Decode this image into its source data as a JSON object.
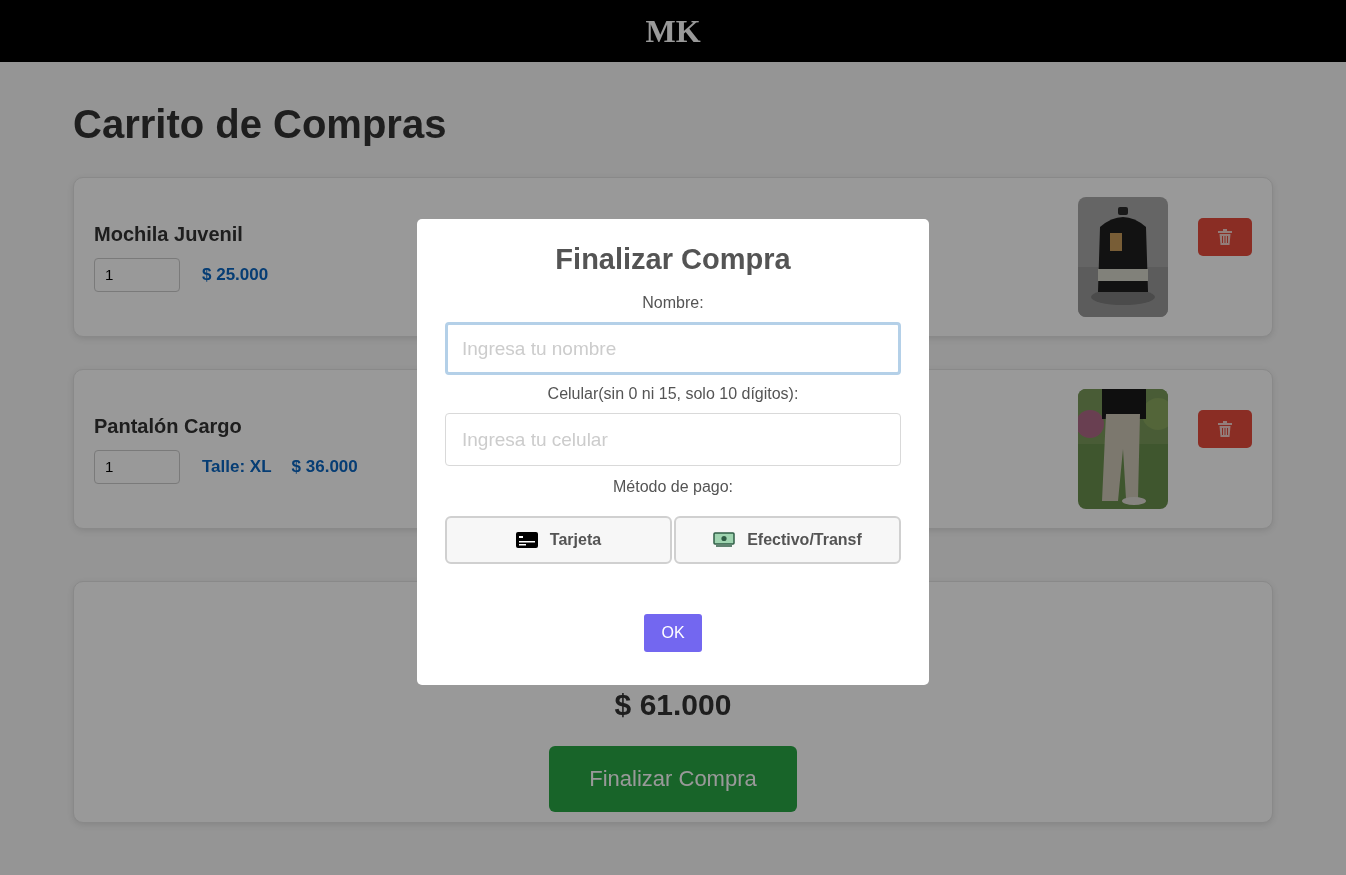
{
  "header": {
    "logo": "MK"
  },
  "page_title": "Carrito de Compras",
  "cart_items": [
    {
      "kind": "backpack",
      "name": "Mochila Juvenil",
      "quantity": "1",
      "price": "$ 25.000"
    },
    {
      "kind": "pants",
      "name": "Pantalón Cargo",
      "quantity": "1",
      "size": "Talle: XL",
      "price": "$ 36.000"
    }
  ],
  "summary": {
    "total": "$ 61.000",
    "checkout_button": "Finalizar Compra"
  },
  "modal": {
    "title": "Finalizar Compra",
    "fields": [
      {
        "label": "Nombre:",
        "placeholder": "Ingresa tu nombre",
        "focused": true
      },
      {
        "label": "Celular(sin 0 ni 15, solo 10 dígitos):",
        "placeholder": "Ingresa tu celular",
        "focused": false
      }
    ],
    "payment_label": "Método de pago:",
    "payment_methods": [
      {
        "kind": "card",
        "label": "Tarjeta",
        "selected": false
      },
      {
        "kind": "cash",
        "label": "Efectivo/Transf",
        "selected": false
      }
    ],
    "ok_button": "OK"
  }
}
